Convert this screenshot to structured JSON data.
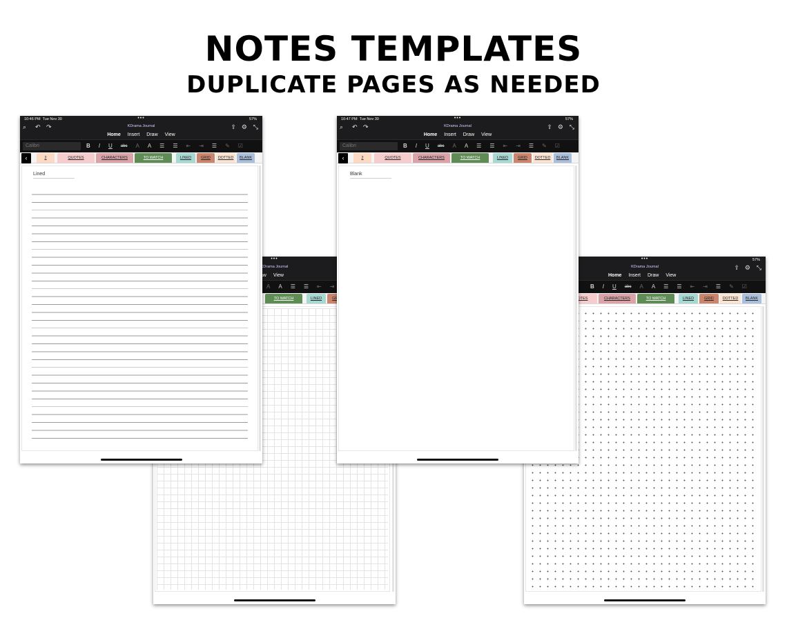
{
  "heading": {
    "title": "NOTES TEMPLATES",
    "subtitle": "DUPLICATE PAGES AS NEEDED"
  },
  "app": {
    "doc_title": "KDrama Journal",
    "date": "Tue Nov 30",
    "battery": "57%",
    "font_name": "Calibri",
    "menu": [
      "Home",
      "Insert",
      "Draw",
      "View"
    ],
    "tools": [
      "B",
      "I",
      "U",
      "abc",
      "A",
      "A",
      "☰",
      "☰",
      "⇤",
      "⇥",
      "☰",
      "✎",
      "☑"
    ]
  },
  "sections": [
    "2",
    "QUOTES",
    "CHARACTERS",
    "TO WATCH",
    "LINED",
    "GRID",
    "DOTTED",
    "BLANK"
  ],
  "sections_dotted_device": [
    "NOTES",
    "CHARACTERS",
    "TO WATCH",
    "LINED",
    "GRID",
    "DOTTED",
    "BLANK"
  ],
  "devices": {
    "lined": {
      "time": "10:46 PM",
      "page_title": "Lined"
    },
    "blank": {
      "time": "10:47 PM",
      "page_title": "Blank"
    }
  },
  "colors": {
    "toolbar_bg": "#1c1c1e",
    "tab_2": "#fbd9c3",
    "tab_quotes": "#f6cccc",
    "tab_characters": "#d9a3a8",
    "tab_to_watch": "#5f8c55",
    "tab_lined": "#a8d8d2",
    "tab_grid": "#c9856d",
    "tab_dotted": "#fbe4d2",
    "tab_blank": "#a9bfdc"
  }
}
